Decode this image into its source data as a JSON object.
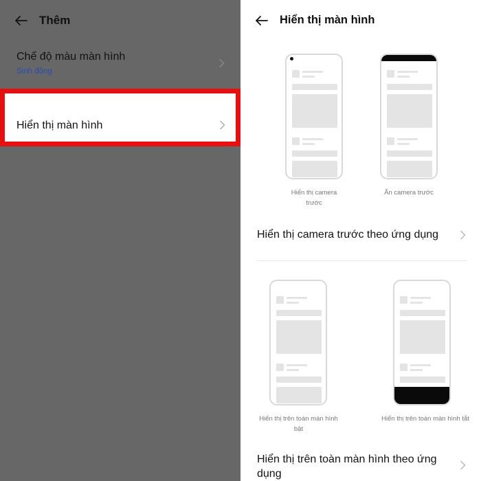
{
  "left": {
    "title": "Thêm",
    "items": [
      {
        "label": "Chế độ màu màn hình",
        "sublabel": "Sinh động"
      },
      {
        "label": "Hiển thị màn hình",
        "highlighted": true
      }
    ],
    "highlight_color": "#e61010"
  },
  "right": {
    "title": "Hiển thị màn hình",
    "options_top": [
      {
        "caption_line1": "Hiển thị camera",
        "caption_line2": "trước"
      },
      {
        "caption_line1": "Ẩn camera trước"
      }
    ],
    "row1_label": "Hiển thị camera trước theo ứng dụng",
    "options_bottom": [
      {
        "caption_line1": "Hiển thị trên toàn màn hình",
        "caption_line2": "bật"
      },
      {
        "caption_line1": "Hiển thị trên toàn màn hình tắt"
      }
    ],
    "row2_label_line1": "Hiển thị trên toàn màn hình theo ứng",
    "row2_label_line2": "dụng"
  },
  "icons": [
    "back-arrow-icon",
    "chevron-right-icon"
  ]
}
